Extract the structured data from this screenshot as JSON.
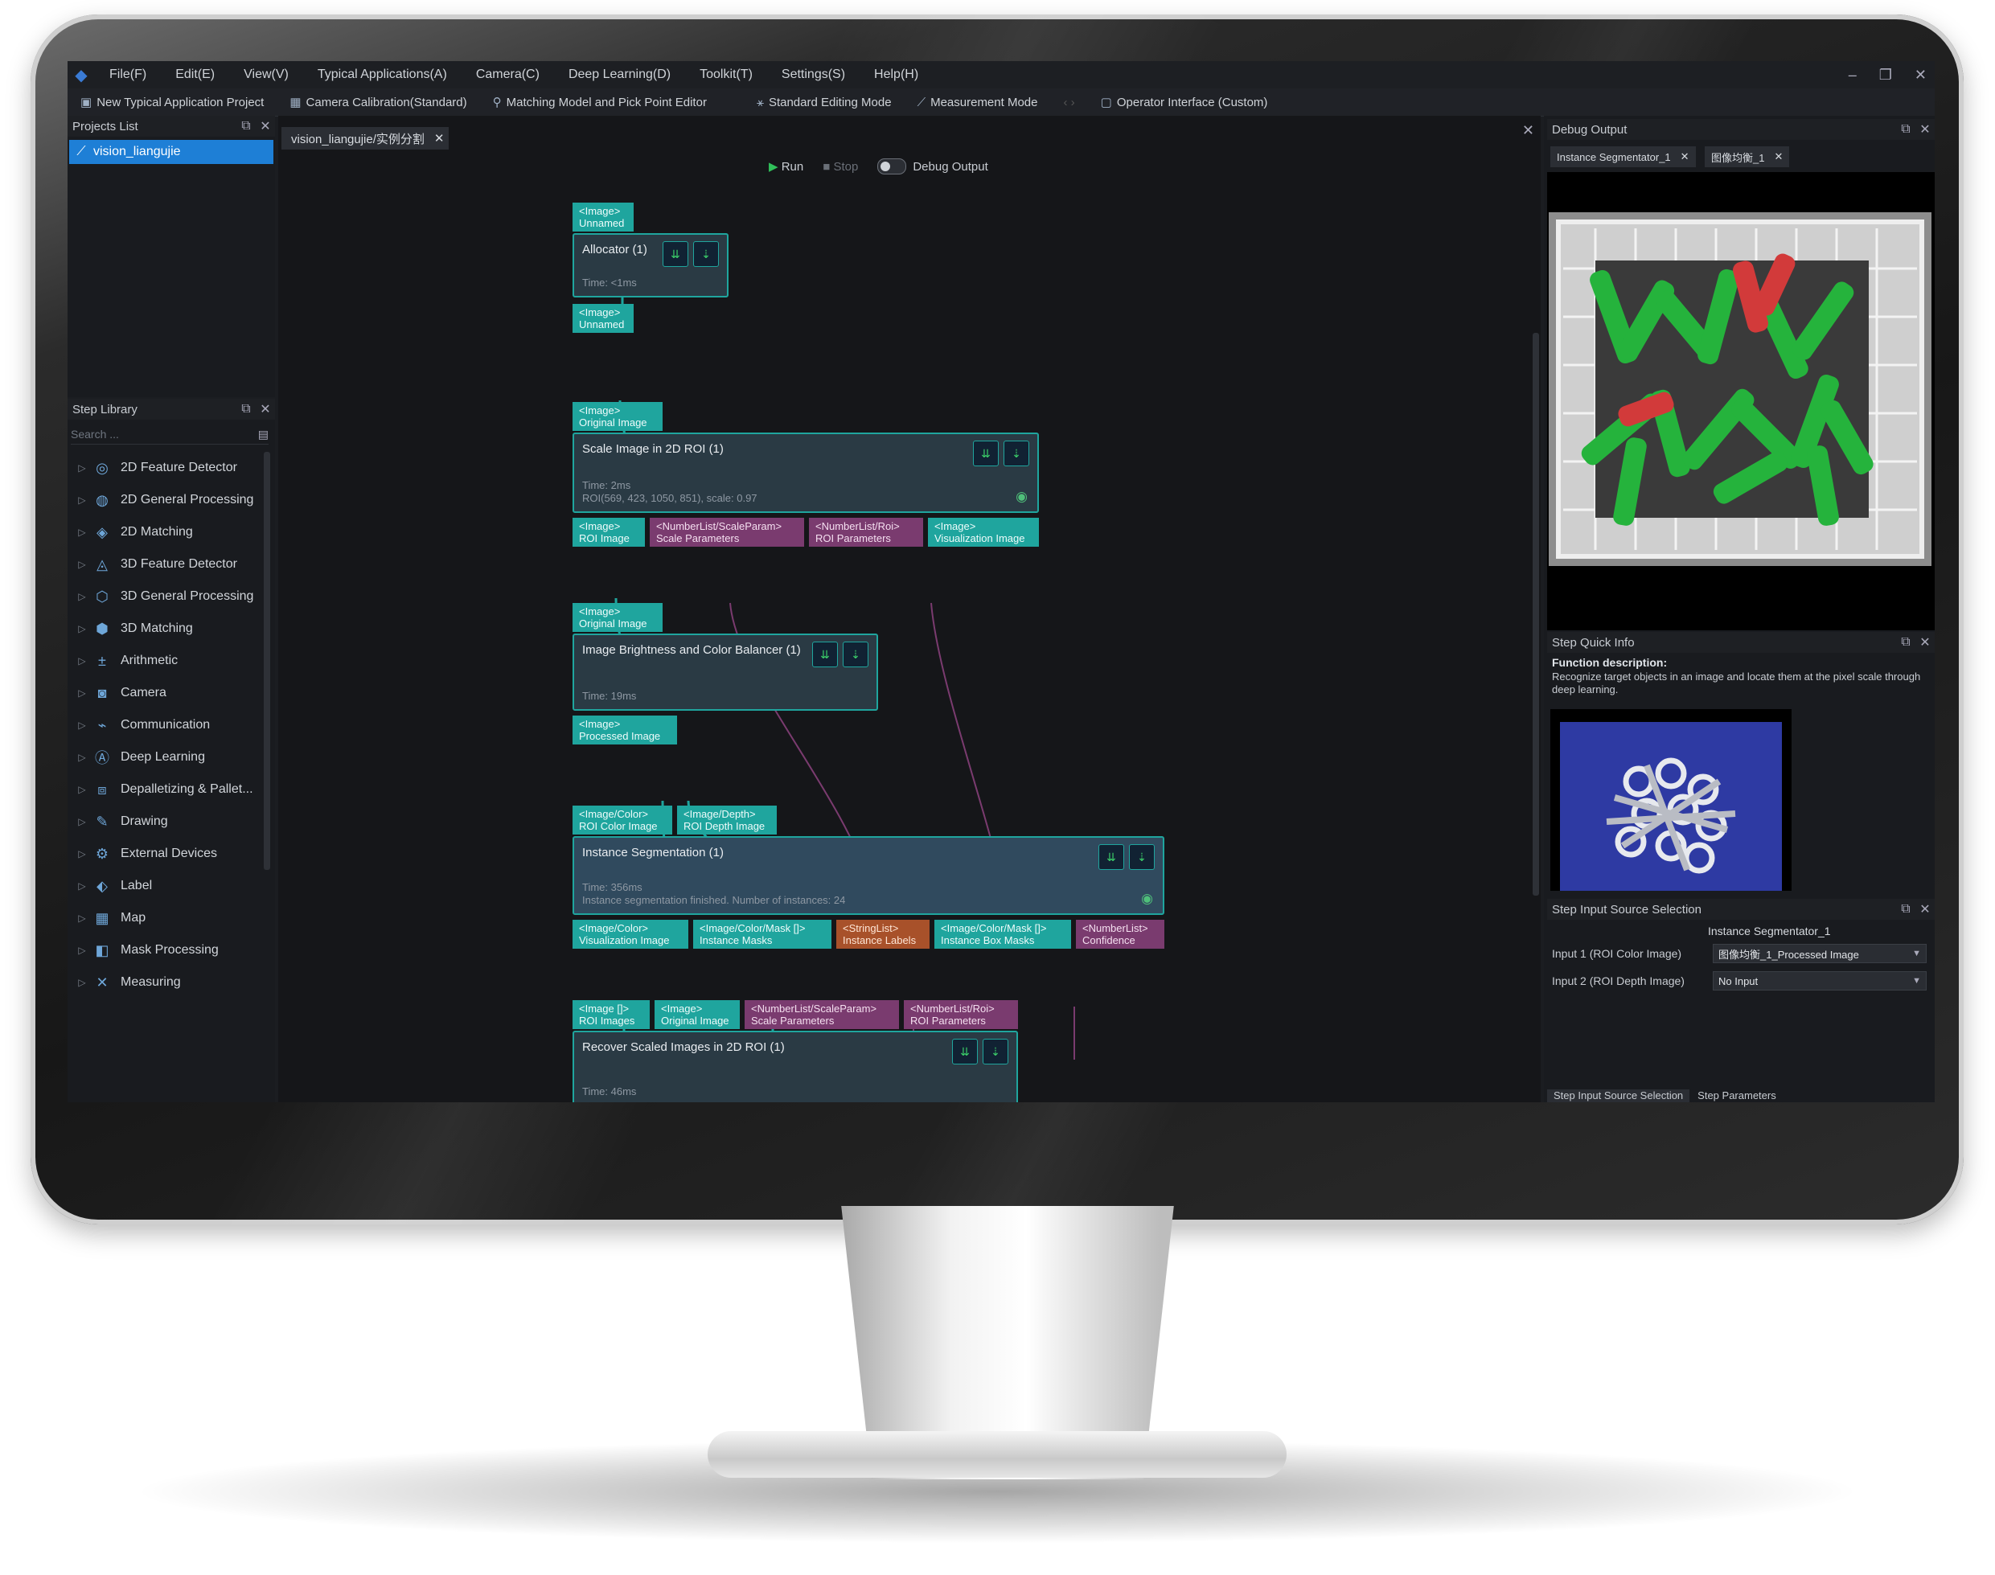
{
  "menubar": {
    "items": [
      "File(F)",
      "Edit(E)",
      "View(V)",
      "Typical Applications(A)",
      "Camera(C)",
      "Deep Learning(D)",
      "Toolkit(T)",
      "Settings(S)",
      "Help(H)"
    ]
  },
  "toolbar": {
    "new_project": "New Typical Application Project",
    "camera_calibration": "Camera Calibration(Standard)",
    "matching_model": "Matching Model and Pick Point Editor",
    "standard_mode": "Standard Editing Mode",
    "measurement_mode": "Measurement Mode",
    "operator_interface": "Operator Interface (Custom)"
  },
  "projects": {
    "title": "Projects List",
    "item": "vision_liangujie"
  },
  "step_library": {
    "title": "Step Library",
    "search_placeholder": "Search ...",
    "items": [
      {
        "label": "2D Feature Detector",
        "icon": "target-icon"
      },
      {
        "label": "2D General Processing",
        "icon": "process-icon"
      },
      {
        "label": "2D Matching",
        "icon": "match-icon"
      },
      {
        "label": "3D Feature Detector",
        "icon": "target3d-icon"
      },
      {
        "label": "3D General Processing",
        "icon": "process3d-icon"
      },
      {
        "label": "3D Matching",
        "icon": "match3d-icon"
      },
      {
        "label": "Arithmetic",
        "icon": "arithmetic-icon"
      },
      {
        "label": "Camera",
        "icon": "camera-icon"
      },
      {
        "label": "Communication",
        "icon": "communication-icon"
      },
      {
        "label": "Deep Learning",
        "icon": "ai-icon"
      },
      {
        "label": "Depalletizing & Pallet...",
        "icon": "boxes-icon"
      },
      {
        "label": "Drawing",
        "icon": "pen-icon"
      },
      {
        "label": "External Devices",
        "icon": "device-icon"
      },
      {
        "label": "Label",
        "icon": "label-icon"
      },
      {
        "label": "Map",
        "icon": "map-icon"
      },
      {
        "label": "Mask Processing",
        "icon": "mask-icon"
      },
      {
        "label": "Measuring",
        "icon": "measure-icon"
      }
    ]
  },
  "canvas": {
    "tab": "vision_liangujie/实例分割",
    "run": "Run",
    "stop": "Stop",
    "debug_output": "Debug Output",
    "nodes": {
      "allocator": {
        "in_type": "<Image>",
        "in_name": "Unnamed",
        "title": "Allocator (1)",
        "time": "Time: <1ms",
        "out_type": "<Image>",
        "out_name": "Unnamed"
      },
      "scale": {
        "in_type": "<Image>",
        "in_name": "Original Image",
        "title": "Scale Image in 2D ROI (1)",
        "time": "Time: 2ms",
        "info": "ROI(569, 423, 1050, 851), scale: 0.97",
        "outputs": [
          {
            "type": "<Image>",
            "name": "ROI Image"
          },
          {
            "type": "<NumberList/ScaleParam>",
            "name": "Scale Parameters"
          },
          {
            "type": "<NumberList/Roi>",
            "name": "ROI Parameters"
          },
          {
            "type": "<Image>",
            "name": "Visualization Image"
          }
        ]
      },
      "brightness": {
        "in_type": "<Image>",
        "in_name": "Original Image",
        "title": "Image Brightness and Color Balancer (1)",
        "time": "Time: 19ms",
        "out_type": "<Image>",
        "out_name": "Processed Image"
      },
      "segmentation": {
        "inputs": [
          {
            "type": "<Image/Color>",
            "name": "ROI Color Image"
          },
          {
            "type": "<Image/Depth>",
            "name": "ROI Depth Image"
          }
        ],
        "title": "Instance Segmentation (1)",
        "time": "Time: 356ms",
        "info": "Instance segmentation finished. Number of instances: 24",
        "outputs": [
          {
            "type": "<Image/Color>",
            "name": "Visualization Image"
          },
          {
            "type": "<Image/Color/Mask []>",
            "name": "Instance Masks"
          },
          {
            "type": "<StringList>",
            "name": "Instance Labels"
          },
          {
            "type": "<Image/Color/Mask []>",
            "name": "Instance Box Masks"
          },
          {
            "type": "<NumberList>",
            "name": "Confidence"
          }
        ]
      },
      "recover": {
        "inputs": [
          {
            "type": "<Image []>",
            "name": "ROI Images"
          },
          {
            "type": "<Image>",
            "name": "Original Image"
          },
          {
            "type": "<NumberList/ScaleParam>",
            "name": "Scale Parameters"
          },
          {
            "type": "<NumberList/Roi>",
            "name": "ROI Parameters"
          }
        ],
        "title": "Recover Scaled Images in 2D ROI (1)",
        "time": "Time: 46ms"
      }
    }
  },
  "debug": {
    "title": "Debug Output",
    "tab1": "Instance Segmentator_1",
    "tab2": "图像均衡_1"
  },
  "quick_info": {
    "title": "Step Quick Info",
    "heading": "Function description:",
    "description": "Recognize target objects in an image and locate them at the pixel scale through deep learning."
  },
  "source_selection": {
    "title": "Step Input Source Selection",
    "step_name": "Instance Segmentator_1",
    "input1_label": "Input 1 (ROI Color Image)",
    "input1_value": "图像均衡_1_Processed Image",
    "input2_label": "Input 2 (ROI Depth Image)",
    "input2_value": "No Input",
    "bottom_tab1": "Step Input Source Selection",
    "bottom_tab2": "Step Parameters"
  },
  "colors": {
    "accent": "#1fa59e",
    "selection": "#1e7fd6",
    "port_purple": "#7a3b6f",
    "port_orange": "#a8512a"
  }
}
